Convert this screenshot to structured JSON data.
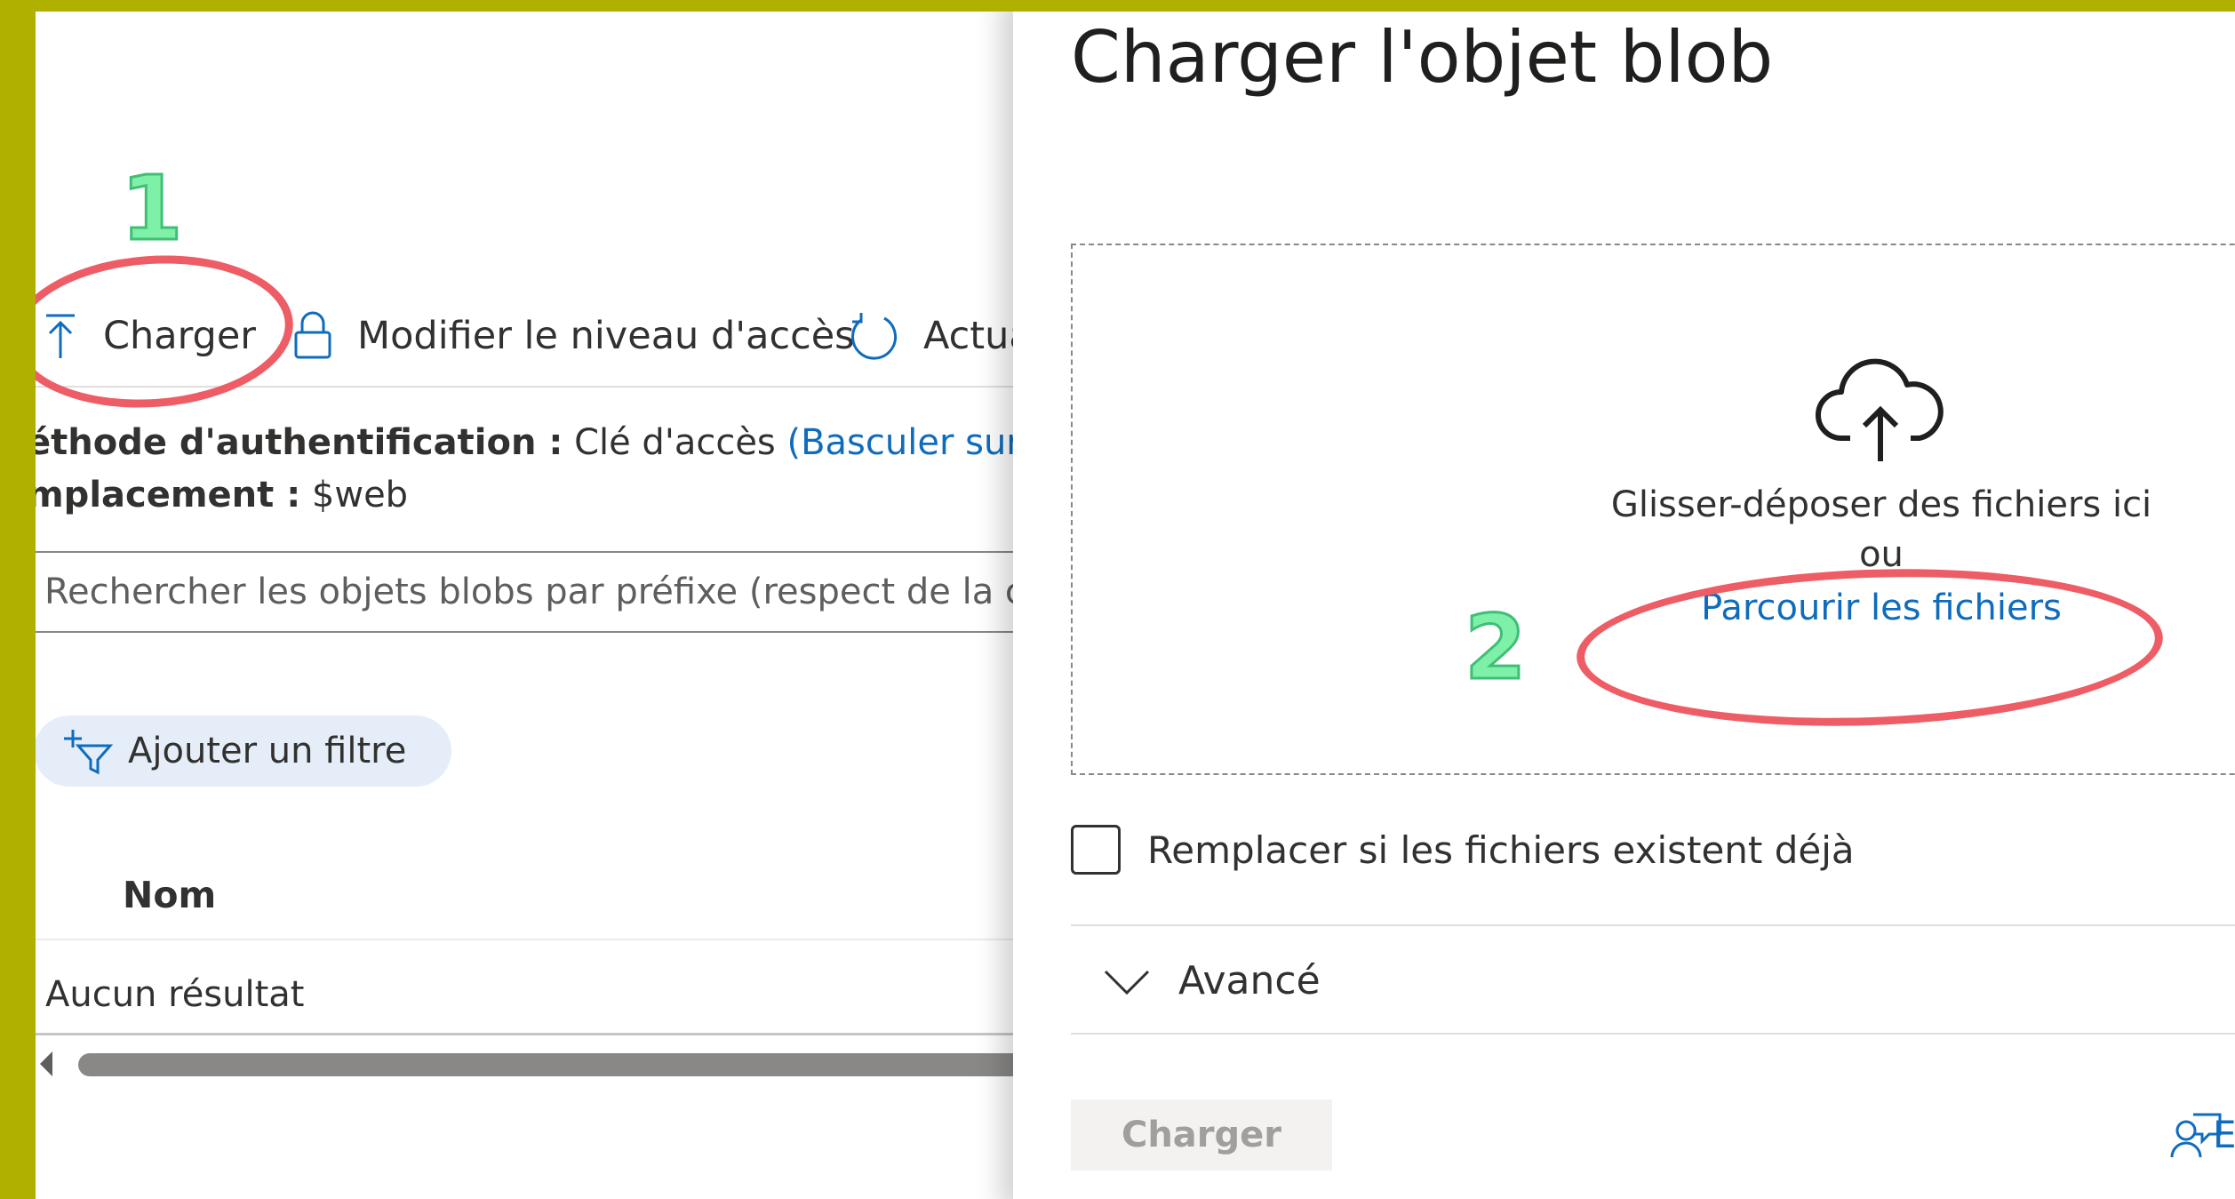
{
  "toolbar": {
    "upload_label": "Charger",
    "access_label": "Modifier le niveau d'accès",
    "refresh_label": "Actua"
  },
  "container_info": {
    "auth_key": "éthode d'authentification :",
    "auth_value": "Clé d'accès",
    "auth_link": "(Basculer sur ur",
    "location_key": "mplacement :",
    "location_value": "$web"
  },
  "search": {
    "placeholder": "Rechercher les objets blobs par préfixe (respect de la cass"
  },
  "filter": {
    "add_filter_label": "Ajouter un filtre"
  },
  "list": {
    "column_name": "Nom",
    "empty_text": "Aucun résultat"
  },
  "upload_panel": {
    "title": "Charger l'objet blob",
    "drop_text": "Glisser-déposer des fichiers ici",
    "or_text": "ou",
    "browse_link": "Parcourir les fichiers",
    "overwrite_label": "Remplacer si les fichiers existent déjà",
    "advanced_label": "Avancé",
    "upload_button": "Charger",
    "feedback_label": "E"
  },
  "annotations": {
    "step1": "1",
    "step2": "2"
  },
  "icons": {
    "upload": "upload-arrow-icon",
    "lock": "lock-icon",
    "refresh": "refresh-icon",
    "filter": "add-filter-icon",
    "cloud": "cloud-upload-icon",
    "chevron": "chevron-down-icon",
    "feedback": "feedback-icon"
  },
  "colors": {
    "accent_link": "#0f6cbd",
    "annotation_ring": "#ee5d66",
    "annotation_number": "#7ef0a8",
    "frame_border": "#b0b000",
    "filter_pill_bg": "#e5eef8"
  }
}
